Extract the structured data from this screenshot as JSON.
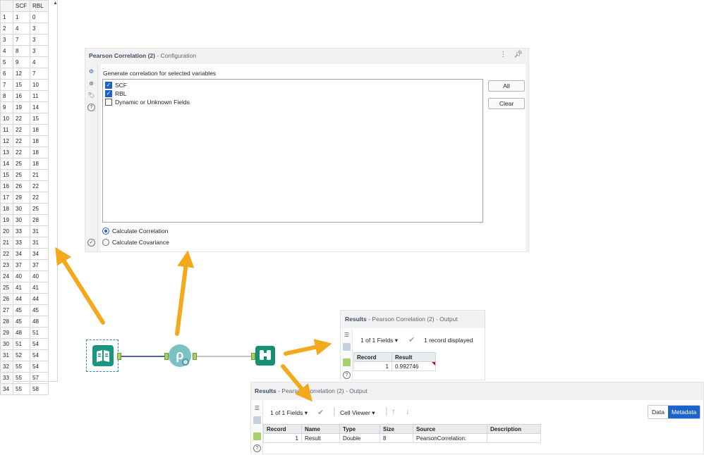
{
  "data_grid": {
    "headers": [
      "",
      "SCF",
      "RBL"
    ],
    "rows": [
      [
        "1",
        "1",
        "0"
      ],
      [
        "2",
        "4",
        "3"
      ],
      [
        "3",
        "7",
        "3"
      ],
      [
        "4",
        "8",
        "3"
      ],
      [
        "5",
        "9",
        "4"
      ],
      [
        "6",
        "12",
        "7"
      ],
      [
        "7",
        "15",
        "10"
      ],
      [
        "8",
        "16",
        "11"
      ],
      [
        "9",
        "19",
        "14"
      ],
      [
        "10",
        "22",
        "15"
      ],
      [
        "11",
        "22",
        "18"
      ],
      [
        "12",
        "22",
        "18"
      ],
      [
        "13",
        "22",
        "18"
      ],
      [
        "14",
        "25",
        "18"
      ],
      [
        "15",
        "25",
        "21"
      ],
      [
        "16",
        "26",
        "22"
      ],
      [
        "17",
        "29",
        "22"
      ],
      [
        "18",
        "30",
        "25"
      ],
      [
        "19",
        "30",
        "28"
      ],
      [
        "20",
        "33",
        "31"
      ],
      [
        "21",
        "33",
        "31"
      ],
      [
        "22",
        "34",
        "34"
      ],
      [
        "23",
        "37",
        "37"
      ],
      [
        "24",
        "40",
        "40"
      ],
      [
        "25",
        "41",
        "41"
      ],
      [
        "26",
        "44",
        "44"
      ],
      [
        "27",
        "45",
        "45"
      ],
      [
        "28",
        "45",
        "48"
      ],
      [
        "29",
        "48",
        "51"
      ],
      [
        "30",
        "51",
        "54"
      ],
      [
        "31",
        "52",
        "54"
      ],
      [
        "32",
        "55",
        "54"
      ],
      [
        "33",
        "55",
        "57"
      ],
      [
        "34",
        "55",
        "58"
      ]
    ]
  },
  "config_panel": {
    "title": "Pearson Correlation (2)",
    "subtitle": " - Configuration",
    "instruction": "Generate correlation for selected variables",
    "fields": [
      {
        "label": "SCF",
        "checked": true
      },
      {
        "label": "RBL",
        "checked": true
      },
      {
        "label": "Dynamic or Unknown Fields",
        "checked": false
      }
    ],
    "buttons": {
      "all": "All",
      "clear": "Clear"
    },
    "options": [
      {
        "label": "Calculate Correlation",
        "selected": true
      },
      {
        "label": "Calculate Covariance",
        "selected": false
      }
    ]
  },
  "workflow": {
    "pearson_glyph": "ρ"
  },
  "results_summary": {
    "title": "Results",
    "subtitle": " - Pearson Correlation (2) - Output",
    "fields_dropdown": "1 of 1 Fields",
    "records_status": "1 record displayed",
    "columns": [
      "Record",
      "Result"
    ],
    "rows": [
      [
        "1",
        "0.992746"
      ]
    ]
  },
  "results_metadata": {
    "title": "Results",
    "subtitle": " - Pearson Correlation (2) - Output",
    "fields_dropdown": "1 of 1 Fields",
    "cell_viewer": "Cell Viewer",
    "view_data": "Data",
    "view_metadata": "Metadata",
    "columns": [
      "Record",
      "Name",
      "Type",
      "Size",
      "Source",
      "Description"
    ],
    "rows": [
      [
        "1",
        "Result",
        "Double",
        "8",
        "PearsonCorrelation:",
        ""
      ]
    ]
  },
  "colors": {
    "accent": "#1c64c9",
    "tool_green": "#18977e",
    "pearson_teal": "#7bc2c4",
    "arrow": "#f4a81c"
  }
}
